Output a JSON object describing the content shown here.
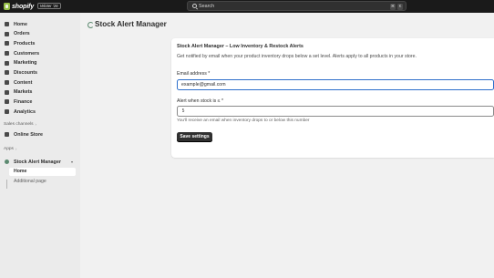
{
  "topbar": {
    "brand": "shopify",
    "edition_badge": "Winter '26",
    "search_label": "Search",
    "shortcut_keys": [
      "⌘",
      "K"
    ]
  },
  "sidebar": {
    "items": [
      {
        "label": "Home",
        "icon": "home-icon"
      },
      {
        "label": "Orders",
        "icon": "orders-icon"
      },
      {
        "label": "Products",
        "icon": "products-icon"
      },
      {
        "label": "Customers",
        "icon": "customers-icon"
      },
      {
        "label": "Marketing",
        "icon": "marketing-icon"
      },
      {
        "label": "Discounts",
        "icon": "discounts-icon"
      },
      {
        "label": "Content",
        "icon": "content-icon"
      },
      {
        "label": "Markets",
        "icon": "markets-icon"
      },
      {
        "label": "Finance",
        "icon": "finance-icon"
      },
      {
        "label": "Analytics",
        "icon": "analytics-icon"
      }
    ],
    "sales_channels_label": "Sales channels",
    "online_store_label": "Online Store",
    "apps_label": "Apps",
    "app": {
      "name": "Stock Alert Manager",
      "pages": [
        "Home",
        "Additional page"
      ]
    }
  },
  "main": {
    "page_title": "Stock Alert Manager",
    "card": {
      "title": "Stock Alert Manager – Low Inventory & Restock Alerts",
      "description": "Get notified by email when your product inventory drops below a set level. Alerts apply to all products in your store.",
      "email_label": "Email address *",
      "email_value": "example@gmail.com",
      "threshold_label": "Alert when stock is ≤ *",
      "threshold_value": "5",
      "threshold_hint": "You'll receive an email when inventory drops to or below this number",
      "save_label": "Save settings"
    }
  },
  "colors": {
    "topbar": "#1a1a1a",
    "sidebar": "#ebebeb",
    "page_bg": "#f1f1f1",
    "focus_ring": "#2c6ecb",
    "primary_button": "#303030",
    "brand_green": "#95bf47"
  }
}
